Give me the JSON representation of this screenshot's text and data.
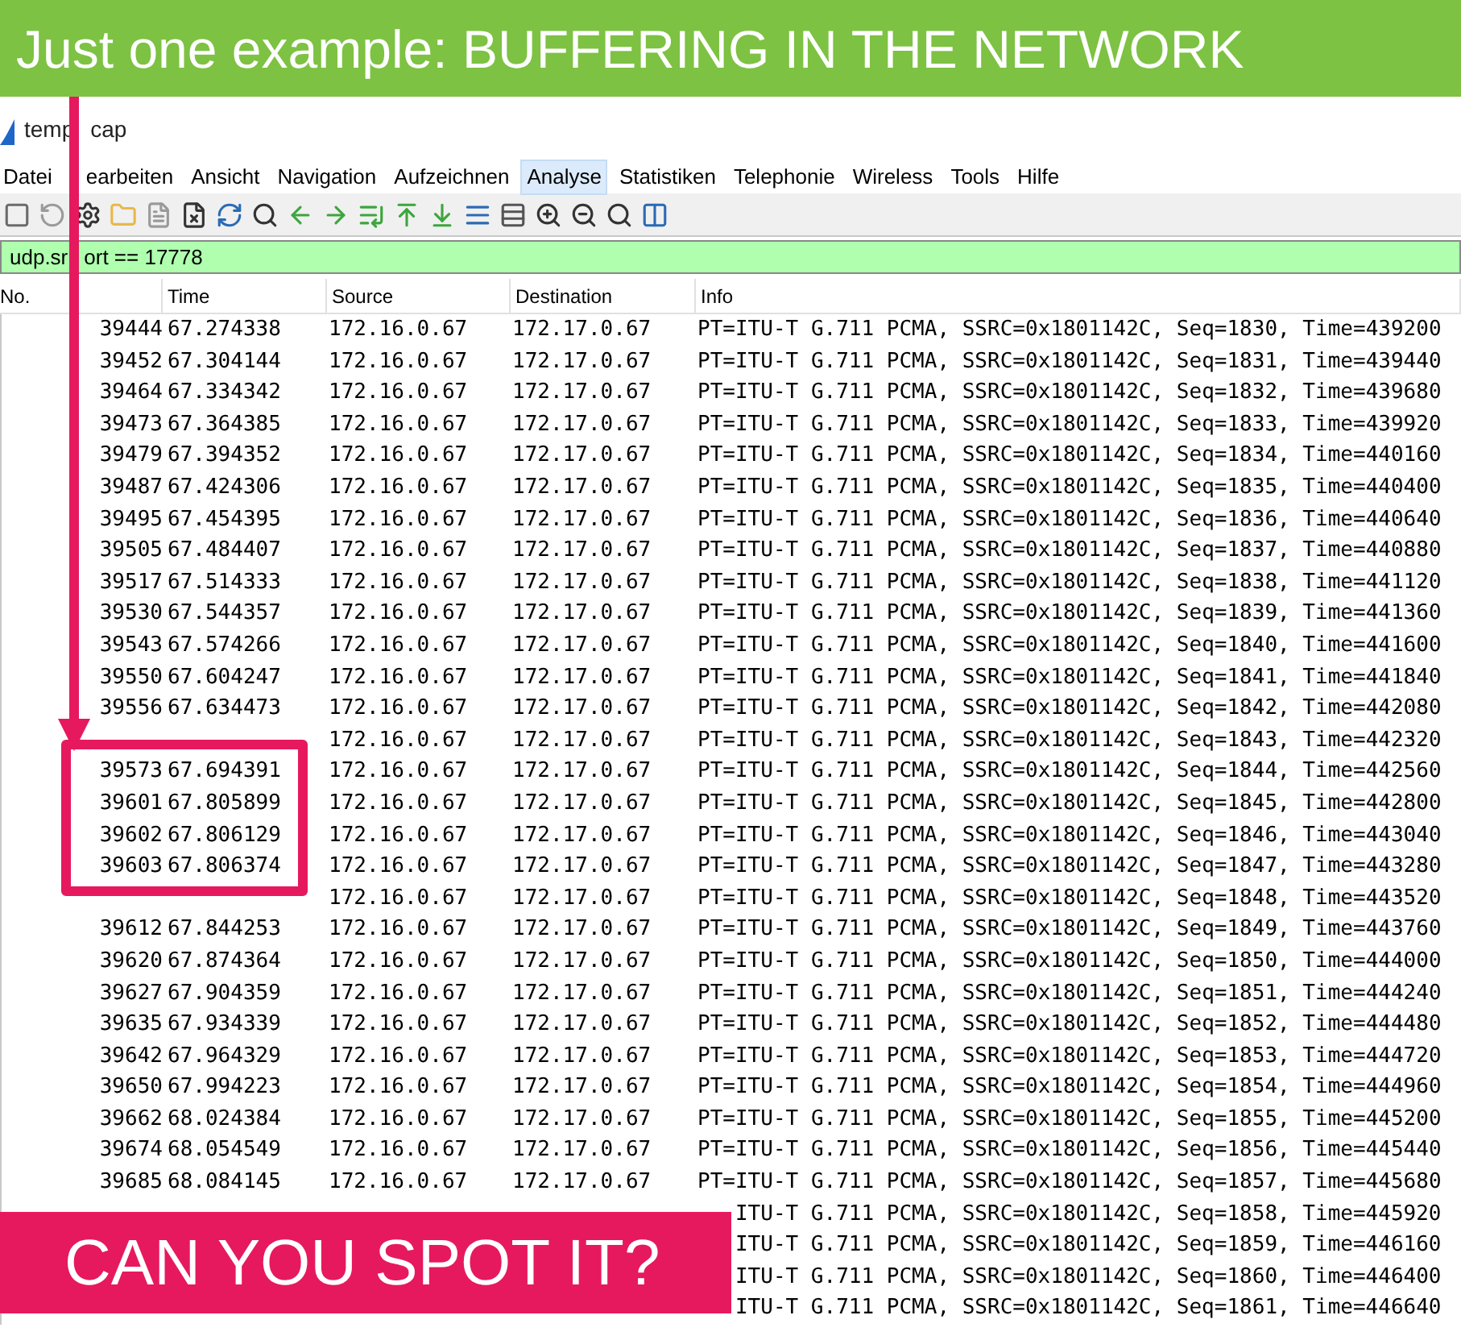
{
  "banner": {
    "title": "Just one example: BUFFERING IN THE NETWORK"
  },
  "window": {
    "title_left": "temp",
    "title_right": "cap"
  },
  "menu": [
    {
      "label": "Datei",
      "selected": false
    },
    {
      "label": "earbeiten",
      "selected": false,
      "kind": "partial"
    },
    {
      "label": "Ansicht",
      "selected": false
    },
    {
      "label": "Navigation",
      "selected": false
    },
    {
      "label": "Aufzeichnen",
      "selected": false
    },
    {
      "label": "Analyse",
      "selected": true
    },
    {
      "label": "Statistiken",
      "selected": false
    },
    {
      "label": "Telephonie",
      "selected": false
    },
    {
      "label": "Wireless",
      "selected": false
    },
    {
      "label": "Tools",
      "selected": false
    },
    {
      "label": "Hilfe",
      "selected": false
    }
  ],
  "filter": {
    "value_left": "udp.sr",
    "value_right": "ort == 17778"
  },
  "table": {
    "columns": [
      "No.",
      "Time",
      "Source",
      "Destination",
      "Info"
    ],
    "rows": [
      {
        "no": "39444",
        "time": "67.274338",
        "source": "172.16.0.67",
        "destination": "172.17.0.67",
        "info": "PT=ITU-T G.711 PCMA, SSRC=0x1801142C, Seq=1830, Time=439200"
      },
      {
        "no": "39452",
        "time": "67.304144",
        "source": "172.16.0.67",
        "destination": "172.17.0.67",
        "info": "PT=ITU-T G.711 PCMA, SSRC=0x1801142C, Seq=1831, Time=439440"
      },
      {
        "no": "39464",
        "time": "67.334342",
        "source": "172.16.0.67",
        "destination": "172.17.0.67",
        "info": "PT=ITU-T G.711 PCMA, SSRC=0x1801142C, Seq=1832, Time=439680"
      },
      {
        "no": "39473",
        "time": "67.364385",
        "source": "172.16.0.67",
        "destination": "172.17.0.67",
        "info": "PT=ITU-T G.711 PCMA, SSRC=0x1801142C, Seq=1833, Time=439920"
      },
      {
        "no": "39479",
        "time": "67.394352",
        "source": "172.16.0.67",
        "destination": "172.17.0.67",
        "info": "PT=ITU-T G.711 PCMA, SSRC=0x1801142C, Seq=1834, Time=440160"
      },
      {
        "no": "39487",
        "time": "67.424306",
        "source": "172.16.0.67",
        "destination": "172.17.0.67",
        "info": "PT=ITU-T G.711 PCMA, SSRC=0x1801142C, Seq=1835, Time=440400"
      },
      {
        "no": "39495",
        "time": "67.454395",
        "source": "172.16.0.67",
        "destination": "172.17.0.67",
        "info": "PT=ITU-T G.711 PCMA, SSRC=0x1801142C, Seq=1836, Time=440640"
      },
      {
        "no": "39505",
        "time": "67.484407",
        "source": "172.16.0.67",
        "destination": "172.17.0.67",
        "info": "PT=ITU-T G.711 PCMA, SSRC=0x1801142C, Seq=1837, Time=440880"
      },
      {
        "no": "39517",
        "time": "67.514333",
        "source": "172.16.0.67",
        "destination": "172.17.0.67",
        "info": "PT=ITU-T G.711 PCMA, SSRC=0x1801142C, Seq=1838, Time=441120"
      },
      {
        "no": "39530",
        "time": "67.544357",
        "source": "172.16.0.67",
        "destination": "172.17.0.67",
        "info": "PT=ITU-T G.711 PCMA, SSRC=0x1801142C, Seq=1839, Time=441360"
      },
      {
        "no": "39543",
        "time": "67.574266",
        "source": "172.16.0.67",
        "destination": "172.17.0.67",
        "info": "PT=ITU-T G.711 PCMA, SSRC=0x1801142C, Seq=1840, Time=441600"
      },
      {
        "no": "39550",
        "time": "67.604247",
        "source": "172.16.0.67",
        "destination": "172.17.0.67",
        "info": "PT=ITU-T G.711 PCMA, SSRC=0x1801142C, Seq=1841, Time=441840"
      },
      {
        "no": "39556",
        "time": "67.634473",
        "source": "172.16.0.67",
        "destination": "172.17.0.67",
        "info": "PT=ITU-T G.711 PCMA, SSRC=0x1801142C, Seq=1842, Time=442080"
      },
      {
        "source": "172.16.0.67",
        "destination": "172.17.0.67",
        "info": "PT=ITU-T G.711 PCMA, SSRC=0x1801142C, Seq=1843, Time=442320"
      },
      {
        "no": "39573",
        "time": "67.694391",
        "source": "172.16.0.67",
        "destination": "172.17.0.67",
        "info": "PT=ITU-T G.711 PCMA, SSRC=0x1801142C, Seq=1844, Time=442560"
      },
      {
        "no": "39601",
        "time": "67.805899",
        "source": "172.16.0.67",
        "destination": "172.17.0.67",
        "info": "PT=ITU-T G.711 PCMA, SSRC=0x1801142C, Seq=1845, Time=442800"
      },
      {
        "no": "39602",
        "time": "67.806129",
        "source": "172.16.0.67",
        "destination": "172.17.0.67",
        "info": "PT=ITU-T G.711 PCMA, SSRC=0x1801142C, Seq=1846, Time=443040"
      },
      {
        "no": "39603",
        "time": "67.806374",
        "source": "172.16.0.67",
        "destination": "172.17.0.67",
        "info": "PT=ITU-T G.711 PCMA, SSRC=0x1801142C, Seq=1847, Time=443280"
      },
      {
        "source": "172.16.0.67",
        "destination": "172.17.0.67",
        "info": "PT=ITU-T G.711 PCMA, SSRC=0x1801142C, Seq=1848, Time=443520"
      },
      {
        "no": "39612",
        "time": "67.844253",
        "source": "172.16.0.67",
        "destination": "172.17.0.67",
        "info": "PT=ITU-T G.711 PCMA, SSRC=0x1801142C, Seq=1849, Time=443760"
      },
      {
        "no": "39620",
        "time": "67.874364",
        "source": "172.16.0.67",
        "destination": "172.17.0.67",
        "info": "PT=ITU-T G.711 PCMA, SSRC=0x1801142C, Seq=1850, Time=444000"
      },
      {
        "no": "39627",
        "time": "67.904359",
        "source": "172.16.0.67",
        "destination": "172.17.0.67",
        "info": "PT=ITU-T G.711 PCMA, SSRC=0x1801142C, Seq=1851, Time=444240"
      },
      {
        "no": "39635",
        "time": "67.934339",
        "source": "172.16.0.67",
        "destination": "172.17.0.67",
        "info": "PT=ITU-T G.711 PCMA, SSRC=0x1801142C, Seq=1852, Time=444480"
      },
      {
        "no": "39642",
        "time": "67.964329",
        "source": "172.16.0.67",
        "destination": "172.17.0.67",
        "info": "PT=ITU-T G.711 PCMA, SSRC=0x1801142C, Seq=1853, Time=444720"
      },
      {
        "no": "39650",
        "time": "67.994223",
        "source": "172.16.0.67",
        "destination": "172.17.0.67",
        "info": "PT=ITU-T G.711 PCMA, SSRC=0x1801142C, Seq=1854, Time=444960"
      },
      {
        "no": "39662",
        "time": "68.024384",
        "source": "172.16.0.67",
        "destination": "172.17.0.67",
        "info": "PT=ITU-T G.711 PCMA, SSRC=0x1801142C, Seq=1855, Time=445200"
      },
      {
        "no": "39674",
        "time": "68.054549",
        "source": "172.16.0.67",
        "destination": "172.17.0.67",
        "info": "PT=ITU-T G.711 PCMA, SSRC=0x1801142C, Seq=1856, Time=445440"
      },
      {
        "no": "39685",
        "time": "68.084145",
        "source": "172.16.0.67",
        "destination": "172.17.0.67",
        "info": "PT=ITU-T G.711 PCMA, SSRC=0x1801142C, Seq=1857, Time=445680"
      },
      {
        "info": "ITU-T G.711 PCMA, SSRC=0x1801142C, Seq=1858, Time=445920"
      },
      {
        "info": "ITU-T G.711 PCMA, SSRC=0x1801142C, Seq=1859, Time=446160"
      },
      {
        "info": "ITU-T G.711 PCMA, SSRC=0x1801142C, Seq=1860, Time=446400"
      },
      {
        "info": "ITU-T G.711 PCMA, SSRC=0x1801142C, Seq=1861, Time=446640"
      }
    ]
  },
  "callout": {
    "text": "CAN YOU SPOT IT?"
  }
}
